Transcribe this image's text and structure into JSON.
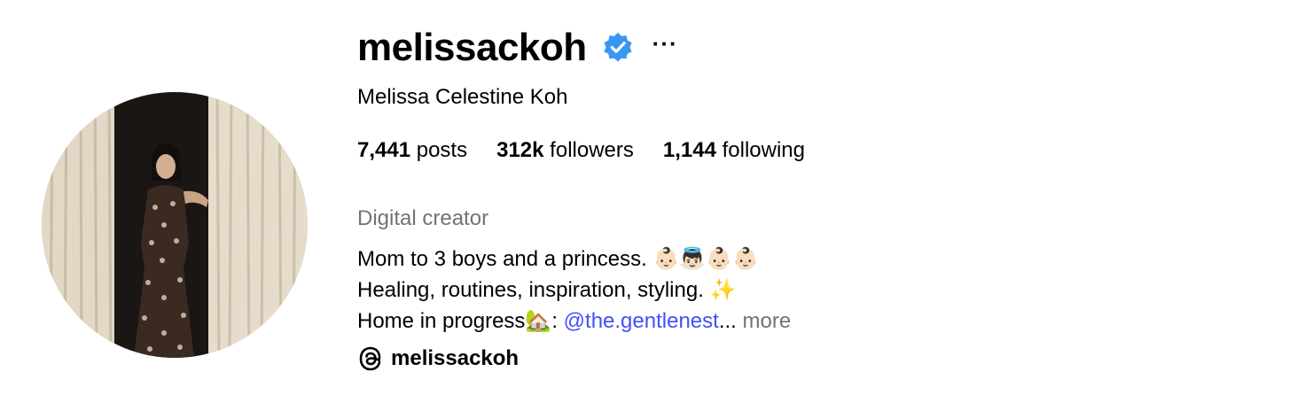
{
  "profile": {
    "username": "melissackoh",
    "full_name": "Melissa Celestine Koh",
    "verified_icon": "verified-badge-icon",
    "more_icon": "more-options-icon",
    "verified_color": "#3897f0"
  },
  "stats": {
    "posts_count": "7,441",
    "posts_label": "posts",
    "followers_count": "312k",
    "followers_label": "followers",
    "following_count": "1,144",
    "following_label": "following"
  },
  "bio": {
    "category": "Digital creator",
    "line1": "Mom to 3 boys and a princess. ",
    "line1_emoji": "👶🏻👼🏻👶🏻👶🏻",
    "line2": "Healing, routines, inspiration, styling. ",
    "line2_emoji": "✨",
    "line3_prefix": "Home in progress",
    "line3_emoji": "🏡",
    "line3_colon": ": ",
    "mention": "@the.gentlenest",
    "ellipsis": "...",
    "more_label": " more",
    "mention_color": "#4150f7"
  },
  "threads": {
    "icon": "threads-icon",
    "handle": "melissackoh"
  }
}
